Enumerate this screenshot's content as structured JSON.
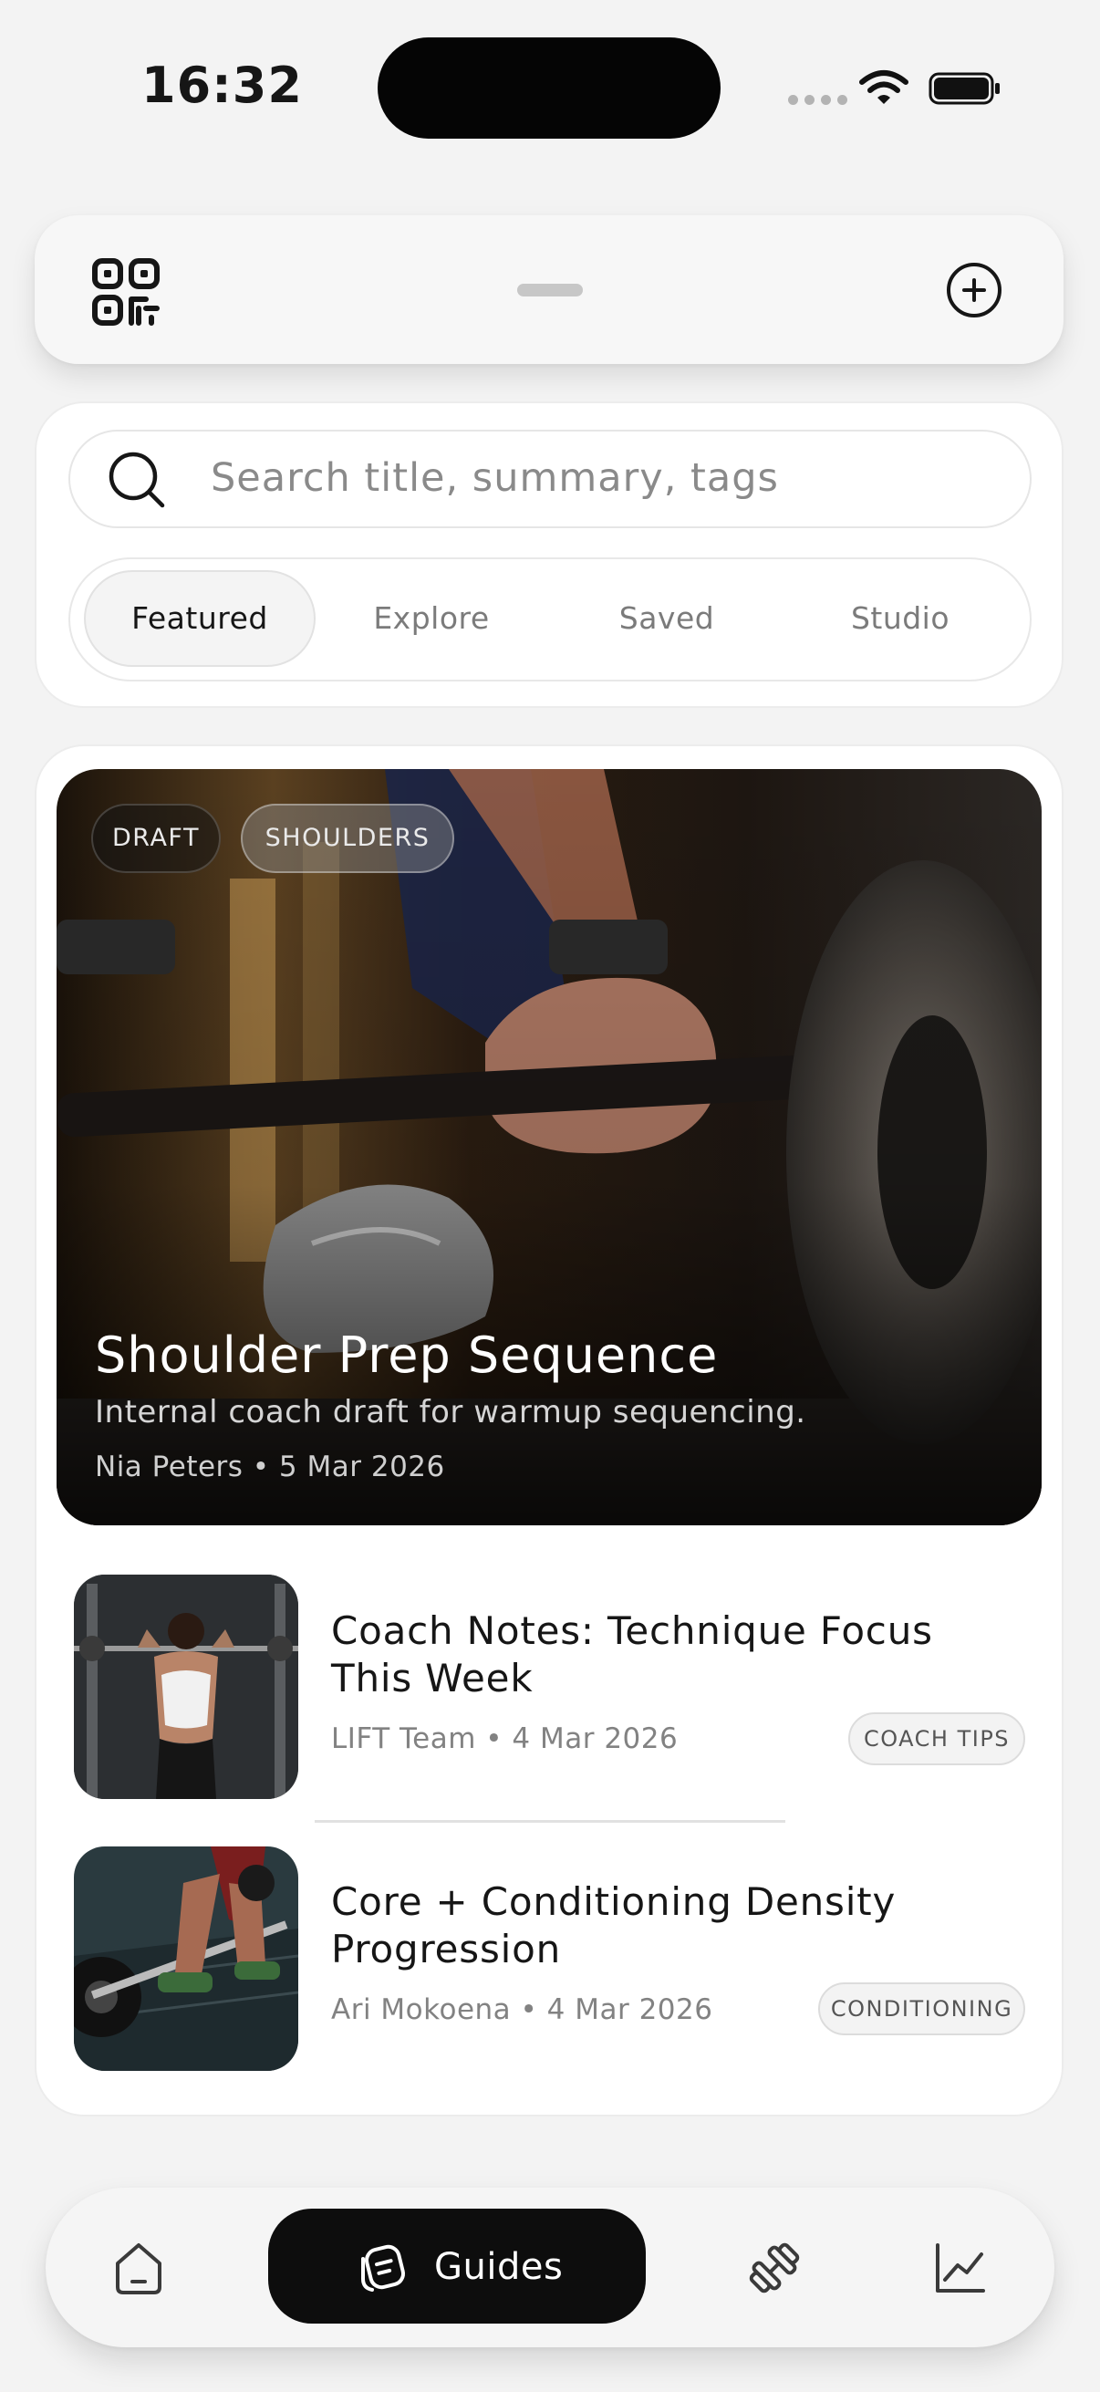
{
  "status_bar": {
    "time": "16:32"
  },
  "search": {
    "placeholder": "Search title, summary, tags"
  },
  "segments": [
    {
      "label": "Featured",
      "active": true
    },
    {
      "label": "Explore",
      "active": false
    },
    {
      "label": "Saved",
      "active": false
    },
    {
      "label": "Studio",
      "active": false
    }
  ],
  "featured": {
    "tags": [
      "DRAFT",
      "SHOULDERS"
    ],
    "title": "Shoulder Prep Sequence",
    "summary": "Internal coach draft for warmup sequencing.",
    "meta": "Nia Peters • 5 Mar 2026"
  },
  "articles": [
    {
      "title": "Coach Notes: Technique Focus This Week",
      "meta": "LIFT Team • 4 Mar 2026",
      "badge": "COACH TIPS"
    },
    {
      "title": "Core + Conditioning Density Progression",
      "meta": "Ari Mokoena • 4 Mar 2026",
      "badge": "CONDITIONING"
    }
  ],
  "tab_bar": {
    "items": [
      {
        "icon": "home-icon",
        "label": ""
      },
      {
        "icon": "guides-icon",
        "label": "Guides",
        "active": true
      },
      {
        "icon": "dumbbell-icon",
        "label": ""
      },
      {
        "icon": "chart-line-icon",
        "label": ""
      }
    ]
  },
  "colors": {
    "accent": "#0d0d0d",
    "background": "#f3f3f3",
    "card": "#ffffff"
  }
}
